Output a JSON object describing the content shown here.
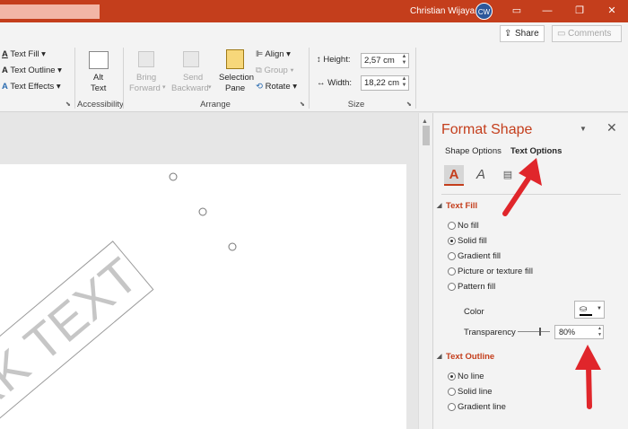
{
  "titlebar": {
    "user_name": "Christian Wijaya",
    "user_initials": "CW",
    "ribbon_display_icon": "ribbon-display-icon",
    "restore_icon": "restore-icon",
    "close_icon": "close-icon"
  },
  "share": {
    "share_label": "Share",
    "comments_label": "Comments"
  },
  "ribbon": {
    "text_fill": "Text Fill",
    "text_outline": "Text Outline",
    "text_effects": "Text Effects",
    "alt_text_1": "Alt",
    "alt_text_2": "Text",
    "accessibility_label": "Accessibility",
    "bring_forward_1": "Bring",
    "bring_forward_2": "Forward",
    "send_backward_1": "Send",
    "send_backward_2": "Backward",
    "selection_pane_1": "Selection",
    "selection_pane_2": "Pane",
    "align": "Align",
    "group": "Group",
    "rotate": "Rotate",
    "arrange_label": "Arrange",
    "height_label": "Height:",
    "height_value": "2,57 cm",
    "width_label": "Width:",
    "width_value": "18,22 cm",
    "size_label": "Size"
  },
  "slide": {
    "watermark_text": "RK TEXT"
  },
  "pane": {
    "title": "Format Shape",
    "tab_shape": "Shape Options",
    "tab_text": "Text Options",
    "text_fill_header": "Text Fill",
    "fill_options": [
      "No fill",
      "Solid fill",
      "Gradient fill",
      "Picture or texture fill",
      "Pattern fill"
    ],
    "selected_fill": "Solid fill",
    "color_label": "Color",
    "transparency_label": "Transparency",
    "transparency_value": "80%",
    "text_outline_header": "Text Outline",
    "outline_options": [
      "No line",
      "Solid line",
      "Gradient line"
    ],
    "selected_outline": "No line"
  },
  "colors": {
    "accent": "#c43e1c",
    "annotation_arrow": "#e0262b"
  }
}
